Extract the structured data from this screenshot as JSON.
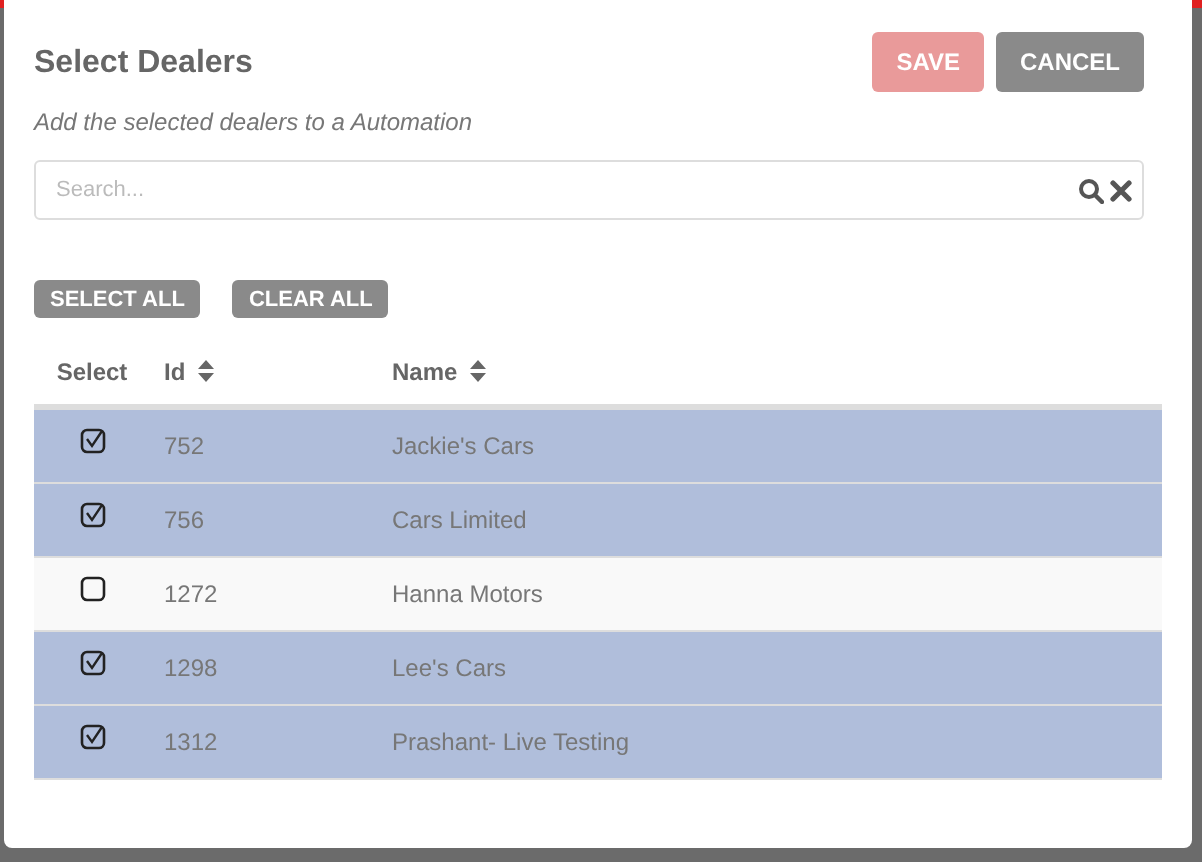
{
  "dialog": {
    "title": "Select Dealers",
    "subtitle": "Add the selected dealers to a Automation"
  },
  "buttons": [
    {
      "label": "SAVE",
      "kind": "primary",
      "disabled": true
    },
    {
      "label": "CANCEL",
      "kind": "secondary",
      "disabled": false
    }
  ],
  "search": {
    "placeholder": "Search..."
  },
  "bulk_actions": [
    "SELECT ALL",
    "CLEAR ALL"
  ],
  "table": {
    "columns": [
      {
        "label": "Select",
        "sortable": false
      },
      {
        "label": "Id",
        "sortable": true
      },
      {
        "label": "Name",
        "sortable": true
      }
    ],
    "rows": [
      {
        "id": "752",
        "name": "Jackie's Cars",
        "selected": true
      },
      {
        "id": "756",
        "name": "Cars Limited",
        "selected": true
      },
      {
        "id": "1272",
        "name": "Hanna Motors",
        "selected": false
      },
      {
        "id": "1298",
        "name": "Lee's Cars",
        "selected": true
      },
      {
        "id": "1312",
        "name": "Prashant- Live Testing",
        "selected": true
      }
    ]
  }
}
